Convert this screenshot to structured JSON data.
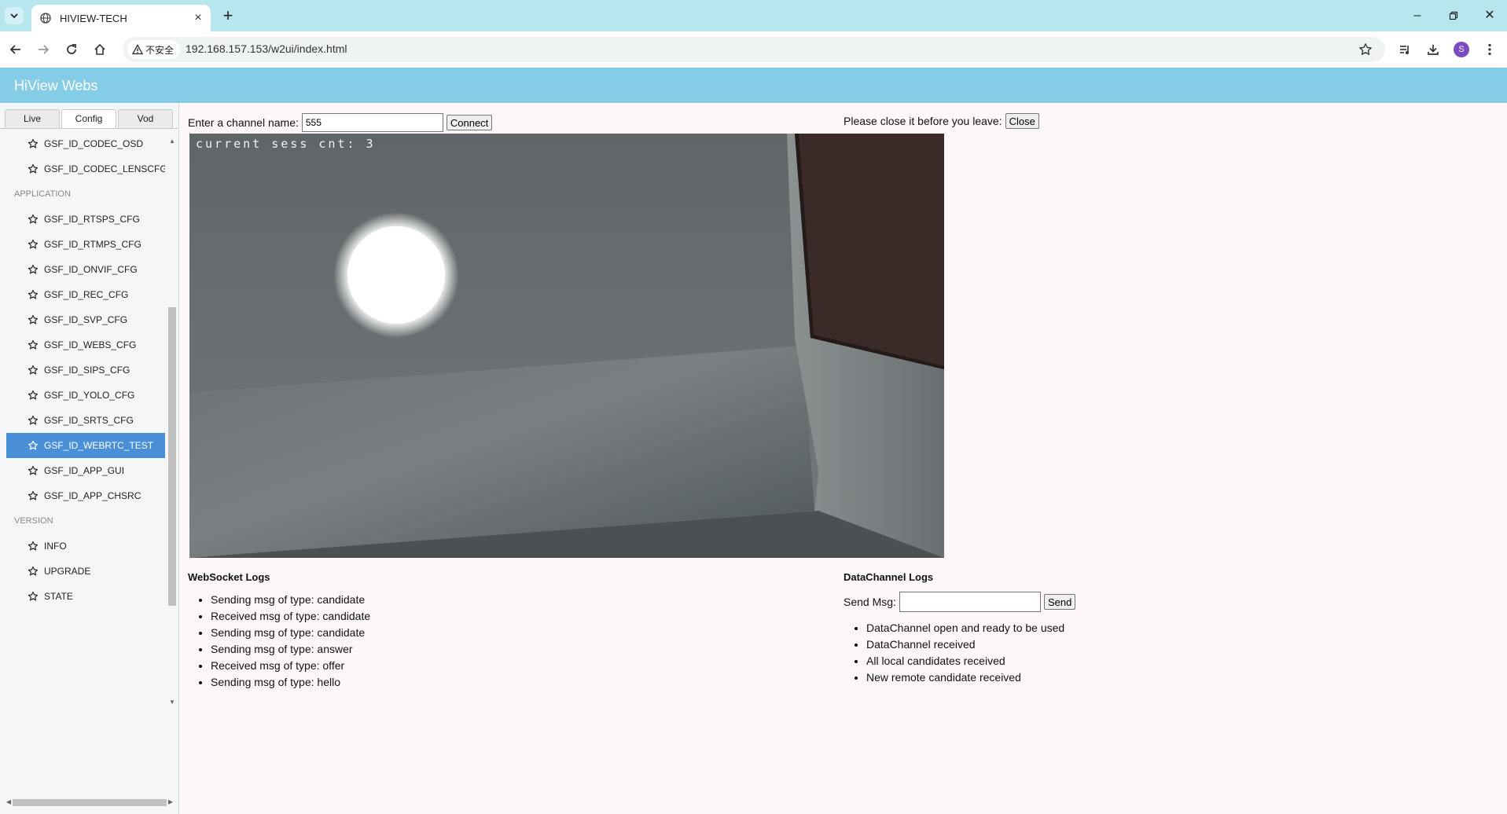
{
  "browser": {
    "tab_title": "HIVIEW-TECH",
    "security_label": "不安全",
    "url": "192.168.157.153/w2ui/index.html",
    "profile_initial": "S"
  },
  "app": {
    "title": "HiView Webs"
  },
  "sidebar": {
    "tabs": [
      "Live",
      "Config",
      "Vod"
    ],
    "active_tab": "Config",
    "tree": [
      {
        "kind": "item",
        "label": "GSF_ID_CODEC_OSD"
      },
      {
        "kind": "item",
        "label": "GSF_ID_CODEC_LENSCFG"
      },
      {
        "kind": "group",
        "label": "APPLICATION"
      },
      {
        "kind": "item",
        "label": "GSF_ID_RTSPS_CFG"
      },
      {
        "kind": "item",
        "label": "GSF_ID_RTMPS_CFG"
      },
      {
        "kind": "item",
        "label": "GSF_ID_ONVIF_CFG"
      },
      {
        "kind": "item",
        "label": "GSF_ID_REC_CFG"
      },
      {
        "kind": "item",
        "label": "GSF_ID_SVP_CFG"
      },
      {
        "kind": "item",
        "label": "GSF_ID_WEBS_CFG"
      },
      {
        "kind": "item",
        "label": "GSF_ID_SIPS_CFG"
      },
      {
        "kind": "item",
        "label": "GSF_ID_YOLO_CFG"
      },
      {
        "kind": "item",
        "label": "GSF_ID_SRTS_CFG"
      },
      {
        "kind": "item",
        "label": "GSF_ID_WEBRTC_TEST",
        "selected": true
      },
      {
        "kind": "item",
        "label": "GSF_ID_APP_GUI"
      },
      {
        "kind": "item",
        "label": "GSF_ID_APP_CHSRC"
      },
      {
        "kind": "group",
        "label": "VERSION"
      },
      {
        "kind": "item",
        "label": "INFO"
      },
      {
        "kind": "item",
        "label": "UPGRADE"
      },
      {
        "kind": "item",
        "label": "STATE"
      }
    ],
    "item_icon": "star-outline-icon",
    "selected_color": "#4a90d9"
  },
  "channel": {
    "label": "Enter a channel name:",
    "value": "555",
    "connect_label": "Connect"
  },
  "leave": {
    "label": "Please close it before you leave:",
    "close_label": "Close"
  },
  "video": {
    "overlay_text": "current sess cnt: 3"
  },
  "websocket_logs": {
    "title": "WebSocket Logs",
    "entries": [
      "Sending msg of type: candidate",
      "Received msg of type: candidate",
      "Sending msg of type: candidate",
      "Sending msg of type: answer",
      "Received msg of type: offer",
      "Sending msg of type: hello"
    ]
  },
  "datachannel_logs": {
    "title": "DataChannel Logs",
    "send_label": "Send Msg:",
    "send_value": "",
    "send_button": "Send",
    "entries": [
      "DataChannel open and ready to be used",
      "DataChannel received",
      "All local candidates received",
      "New remote candidate received"
    ]
  },
  "colors": {
    "tabbar": "#b8e6ef",
    "app_header": "#85cde6",
    "page_bg": "#fdf8f7"
  }
}
